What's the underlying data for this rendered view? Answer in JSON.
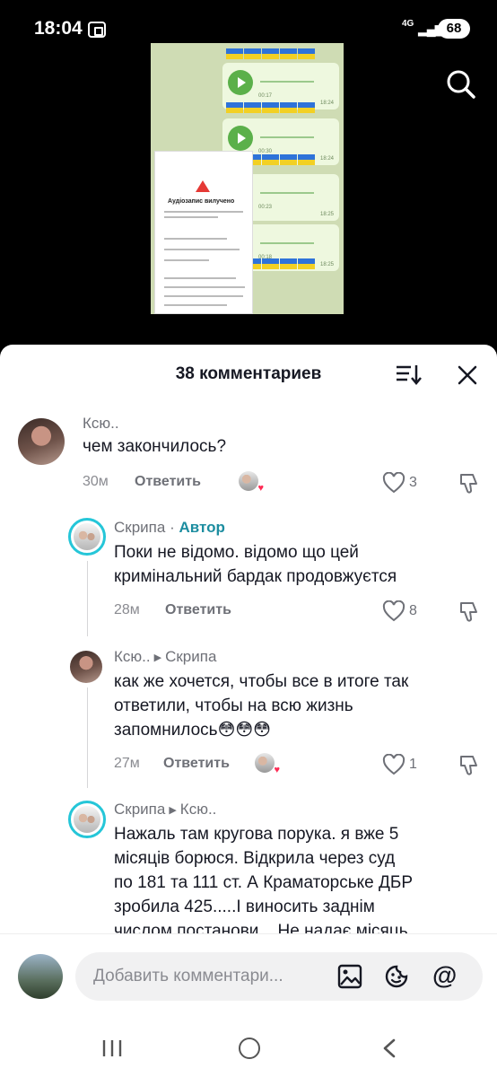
{
  "status_bar": {
    "time": "18:04",
    "network": "4G",
    "battery": "68"
  },
  "top_actions": {
    "search_icon": "search-icon"
  },
  "sheet": {
    "title": "38 комментариев",
    "sort_icon": "sort-icon",
    "close_icon": "close-icon"
  },
  "comments": [
    {
      "user": "Ксю..",
      "text": "чем закончилось?",
      "time": "30м",
      "reply_label": "Ответить",
      "likes": "3",
      "creator_liked": true
    },
    {
      "user": "Скрипа",
      "author_sep": "·",
      "author_tag": "Автор",
      "text_lines": [
        "Поки не відомо. відомо що цей",
        "кримінальний бардак продовжуєтся"
      ],
      "time": "28м",
      "reply_label": "Ответить",
      "likes": "8"
    },
    {
      "user": "Ксю..",
      "reply_to": "Скрипа",
      "text_lines": [
        "как же хочется, чтобы все в итоге так",
        "ответили, чтобы на всю жизнь",
        "запомнилось😳😳😳"
      ],
      "time": "27м",
      "reply_label": "Ответить",
      "likes": "1",
      "creator_liked": true
    },
    {
      "user": "Скрипа",
      "reply_to": "Ксю..",
      "text_lines": [
        "Нажаль там кругова порука. я вже 5",
        "місяців борюся. Відкрила через суд",
        "по 181 та 111 ст. А Краматорське ДБР",
        "зробила 425.....І виносить заднім",
        "числом постанови... Не надає місяць"
      ]
    }
  ],
  "composer": {
    "placeholder": "Добавить комментари...",
    "image_icon": "image-icon",
    "emoji_icon": "emoji-icon",
    "mention_symbol": "@"
  },
  "video_preview": {
    "durations": [
      "00:17",
      "00:30",
      "00:23",
      "00:18"
    ],
    "times": [
      "18:24",
      "18:24",
      "18:25",
      "18:25"
    ],
    "inset_title": "Аудіозапис вилучено"
  }
}
